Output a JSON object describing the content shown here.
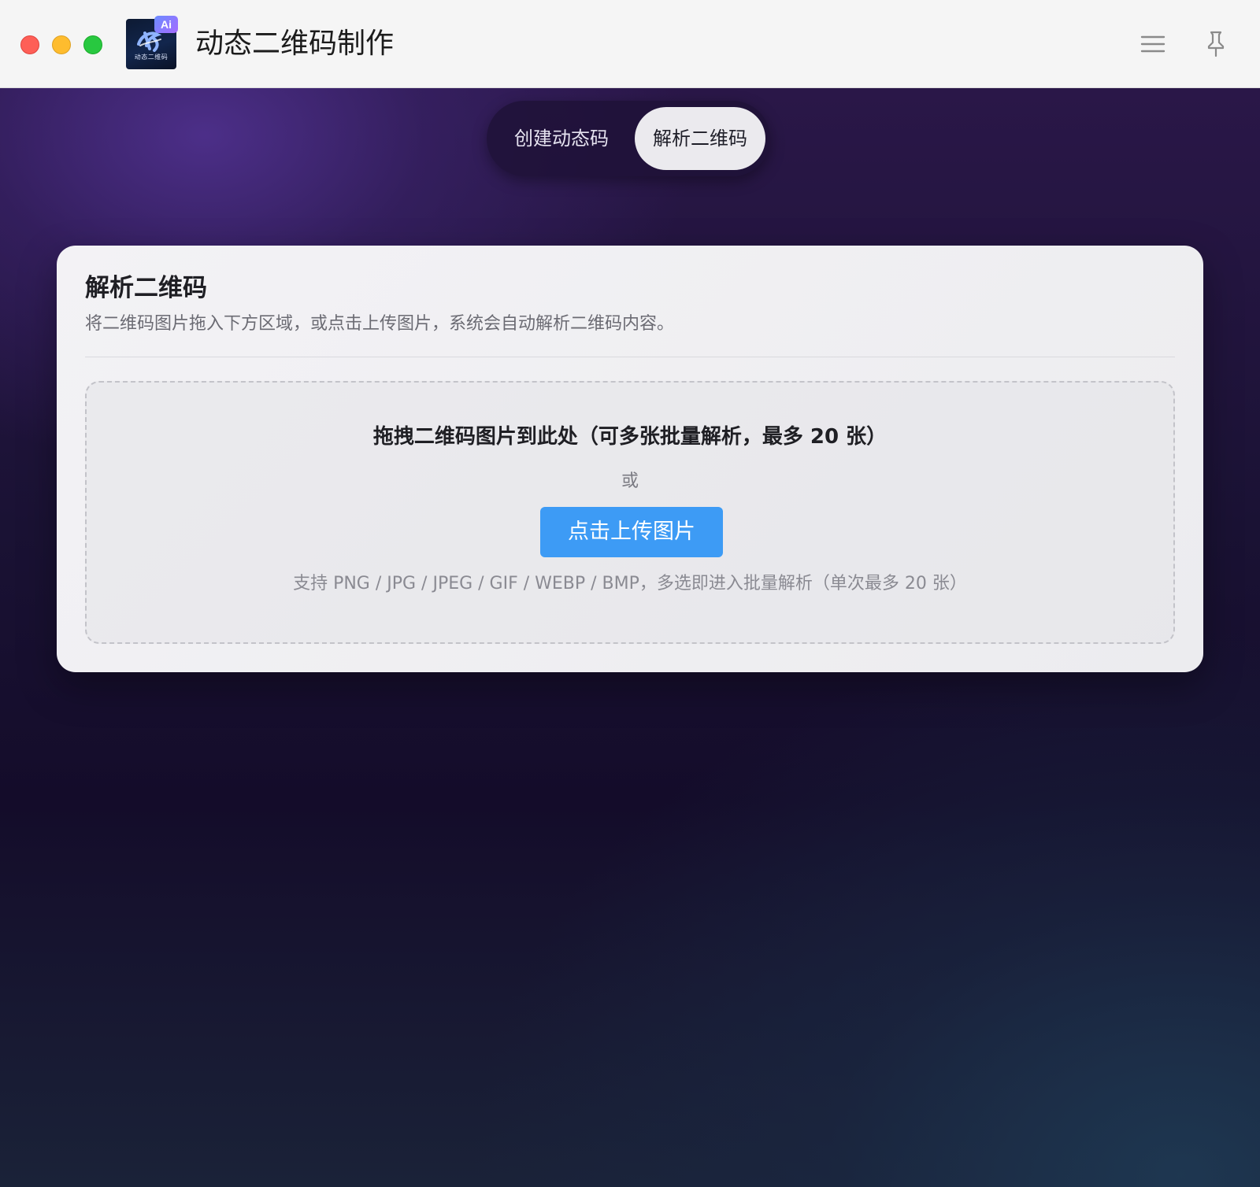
{
  "window": {
    "app_title": "动态二维码制作",
    "logo": {
      "badge": "Ai",
      "caption": "动态二维码"
    },
    "titlebar_icons": [
      "menu-icon",
      "pin-icon"
    ]
  },
  "tabs": [
    {
      "label": "创建动态码",
      "active": false
    },
    {
      "label": "解析二维码",
      "active": true
    }
  ],
  "card": {
    "title": "解析二维码",
    "description": "将二维码图片拖入下方区域，或点击上传图片，系统会自动解析二维码内容。",
    "dropzone": {
      "title": "拖拽二维码图片到此处（可多张批量解析，最多 20 张）",
      "or_text": "或",
      "upload_label": "点击上传图片",
      "hint": "支持 PNG / JPG / JPEG / GIF / WEBP / BMP，多选即进入批量解析（单次最多 20 张）"
    }
  },
  "colors": {
    "accent": "#3d9bf5",
    "close": "#fe5f57",
    "minimize": "#febc2e",
    "maximize": "#28c840"
  }
}
